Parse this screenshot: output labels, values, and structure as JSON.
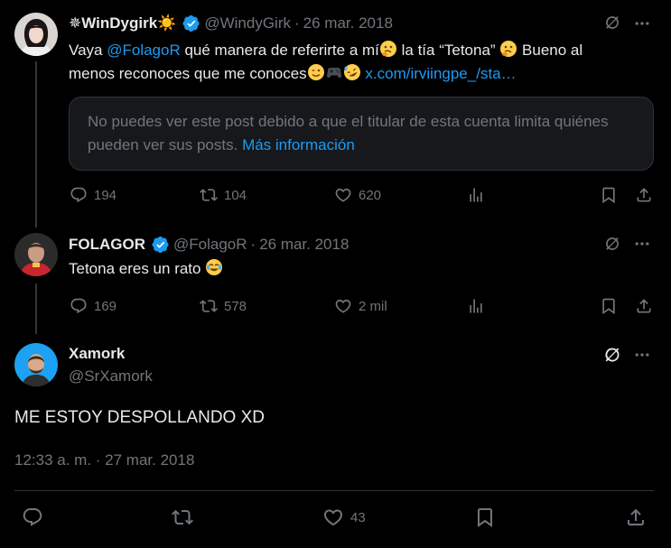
{
  "tweets": [
    {
      "name": "✵WinDygirk☀️",
      "handle": "@WindyGirk",
      "separator": "·",
      "date": "26 mar. 2018",
      "text_before_mention": "Vaya ",
      "mention": "@FolagoR",
      "text_after_mention": " qué manera de referirte a mí",
      "text_after_emoji1": " la tía “Tetona” ",
      "text_after_emoji2": " Bueno al",
      "text_line2": "menos reconoces que me conoces",
      "link": "x.com/irviingpe_/sta…",
      "notice_text": "No puedes ver este post debido a que el titular de esta cuenta limita quiénes pueden ver sus posts.",
      "notice_link": "Más información",
      "replies": "194",
      "reposts": "104",
      "likes": "620"
    },
    {
      "name": "FOLAGOR",
      "handle": "@FolagoR",
      "separator": "·",
      "date": "26 mar. 2018",
      "text": "Tetona eres un rato",
      "replies": "169",
      "reposts": "578",
      "likes": "2 mil"
    }
  ],
  "main_tweet": {
    "name": "Xamork",
    "handle": "@SrXamork",
    "text": "ME ESTOY DESPOLLANDO XD",
    "timestamp": "12:33 a. m. · 27 mar. 2018",
    "likes": "43"
  },
  "colors": {
    "accent": "#1d9bf0",
    "muted": "#71767b",
    "text": "#e7e9ea",
    "background": "#000000"
  },
  "icons": [
    "reply-icon",
    "repost-icon",
    "like-icon",
    "views-icon",
    "bookmark-icon",
    "share-icon",
    "grok-icon",
    "more-icon",
    "verified-badge-icon"
  ]
}
